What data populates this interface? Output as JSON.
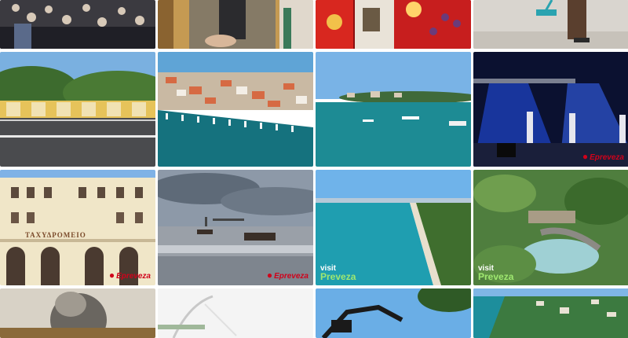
{
  "gallery": {
    "building_sign": "ΤΑΧΥΔΡΟΜΕΙΟ",
    "watermarks": {
      "pin_brand": "Epreveza",
      "visit_prefix": "visit",
      "visit_brand": "Preveza"
    },
    "colors": {
      "sea": "#17838f",
      "sky": "#4f9bd8",
      "stage_blue": "#1c3fb8"
    }
  }
}
